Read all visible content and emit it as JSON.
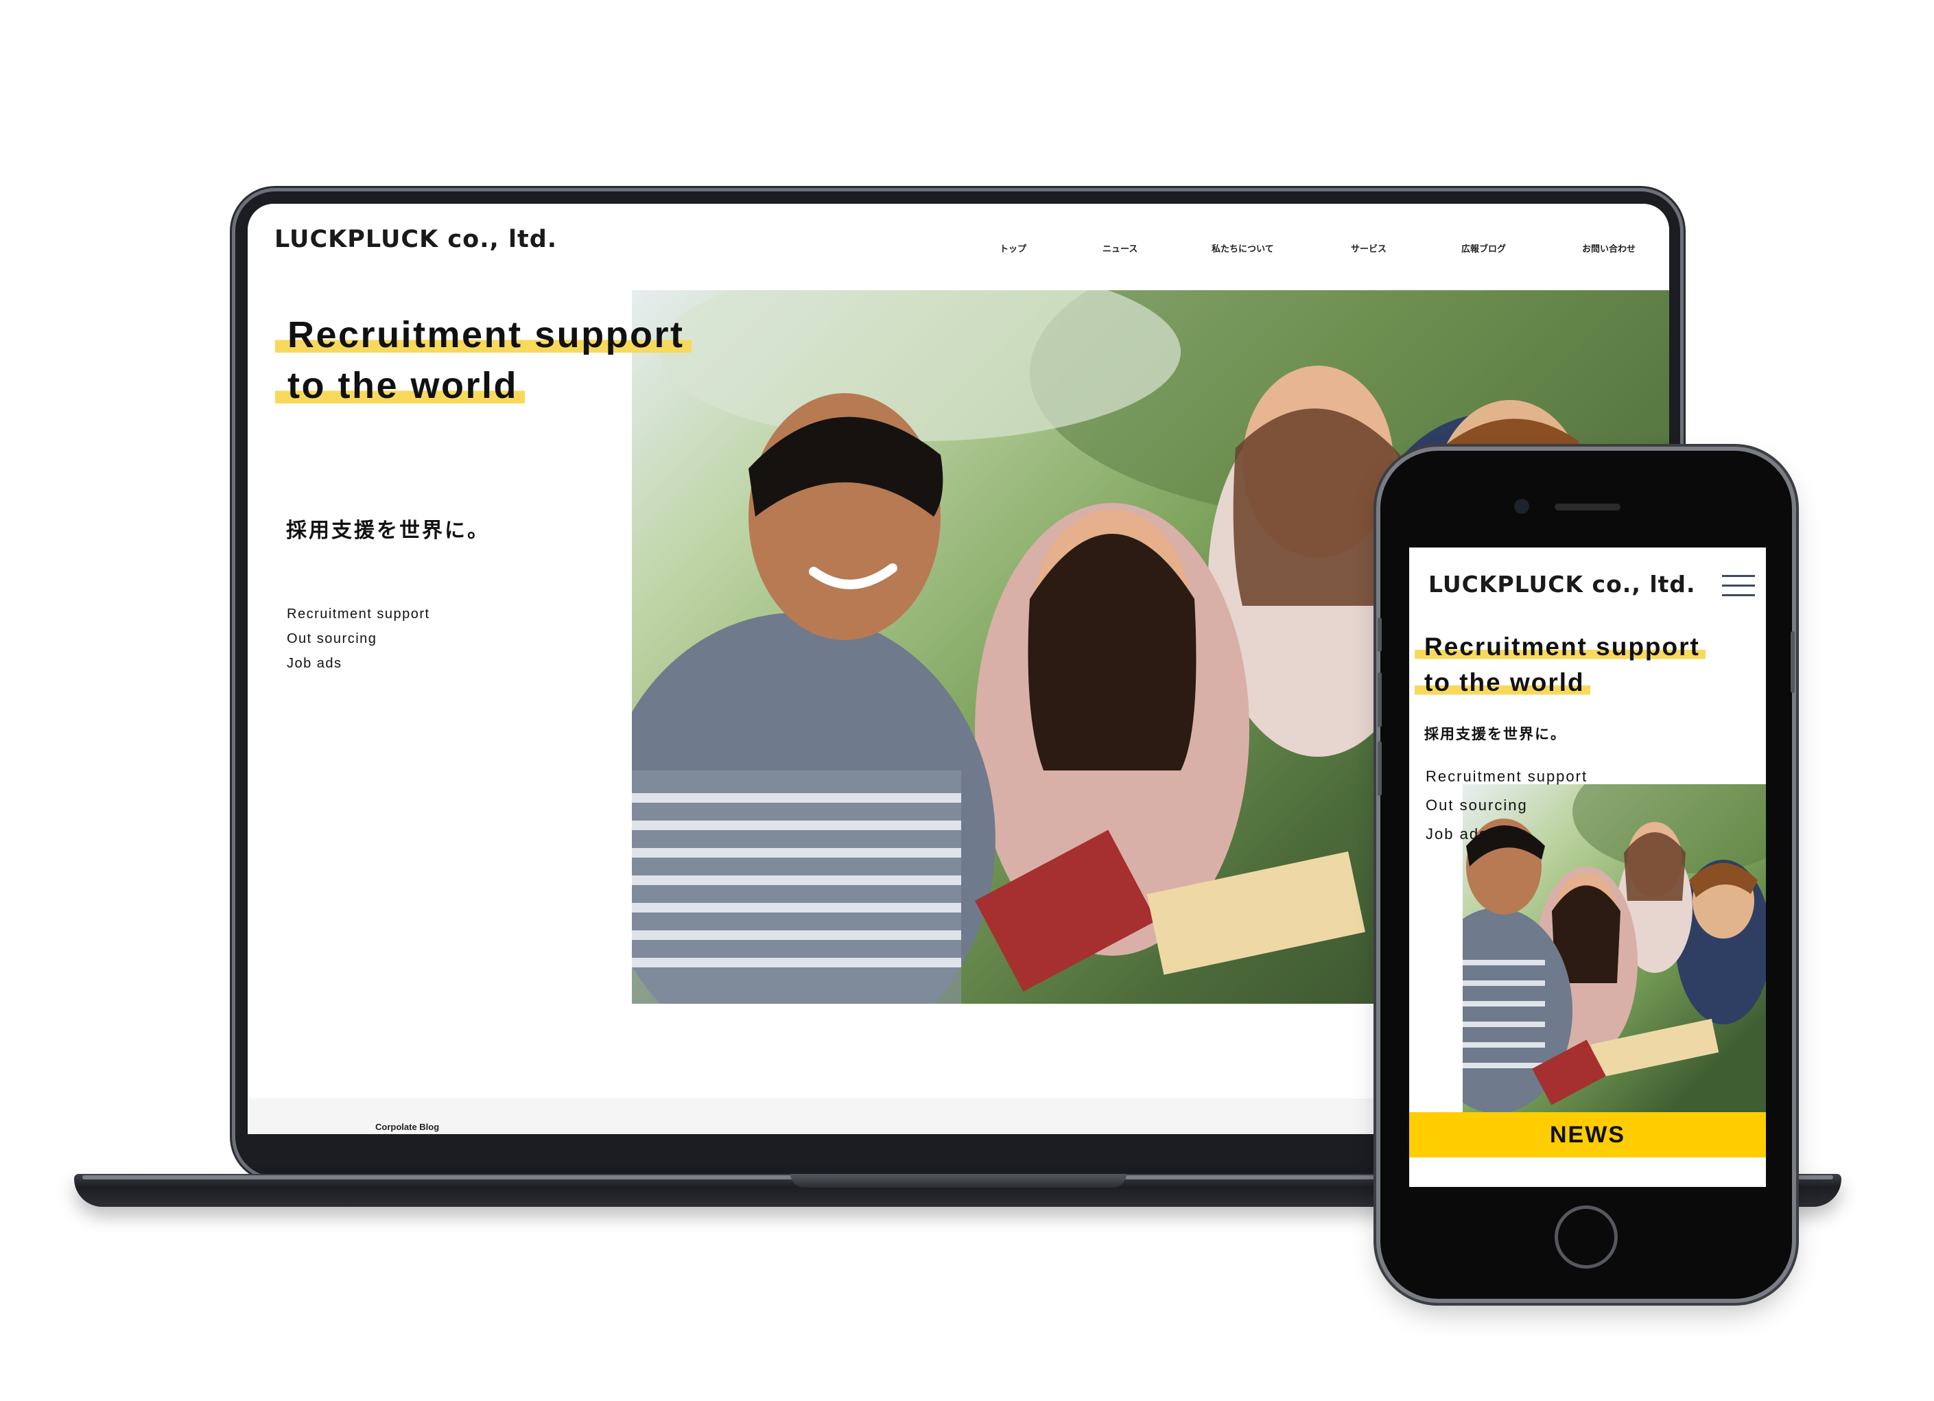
{
  "desktop": {
    "logo": "LUCKPLUCK co., ltd.",
    "nav": [
      "トップ",
      "ニュース",
      "私たちについて",
      "サービス",
      "広報ブログ",
      "お問い合わせ"
    ],
    "headline": [
      "Recruitment support",
      "to the world"
    ],
    "subtitle": "採用支援を世界に。",
    "services": [
      "Recruitment support",
      "Out sourcing",
      "Job ads"
    ],
    "footer_label": "Corpolate Blog"
  },
  "mobile": {
    "logo": "LUCKPLUCK co., ltd.",
    "headline": [
      "Recruitment support",
      "to the world"
    ],
    "subtitle": "採用支援を世界に。",
    "services": [
      "Recruitment support",
      "Out sourcing",
      "Job ads"
    ],
    "news_label": "NEWS",
    "menu_icon": "hamburger-menu-icon"
  },
  "colors": {
    "highlight": "#f8d95b",
    "news_bar": "#ffcd00",
    "text": "#111111",
    "device_frame": "#1b1d22"
  }
}
